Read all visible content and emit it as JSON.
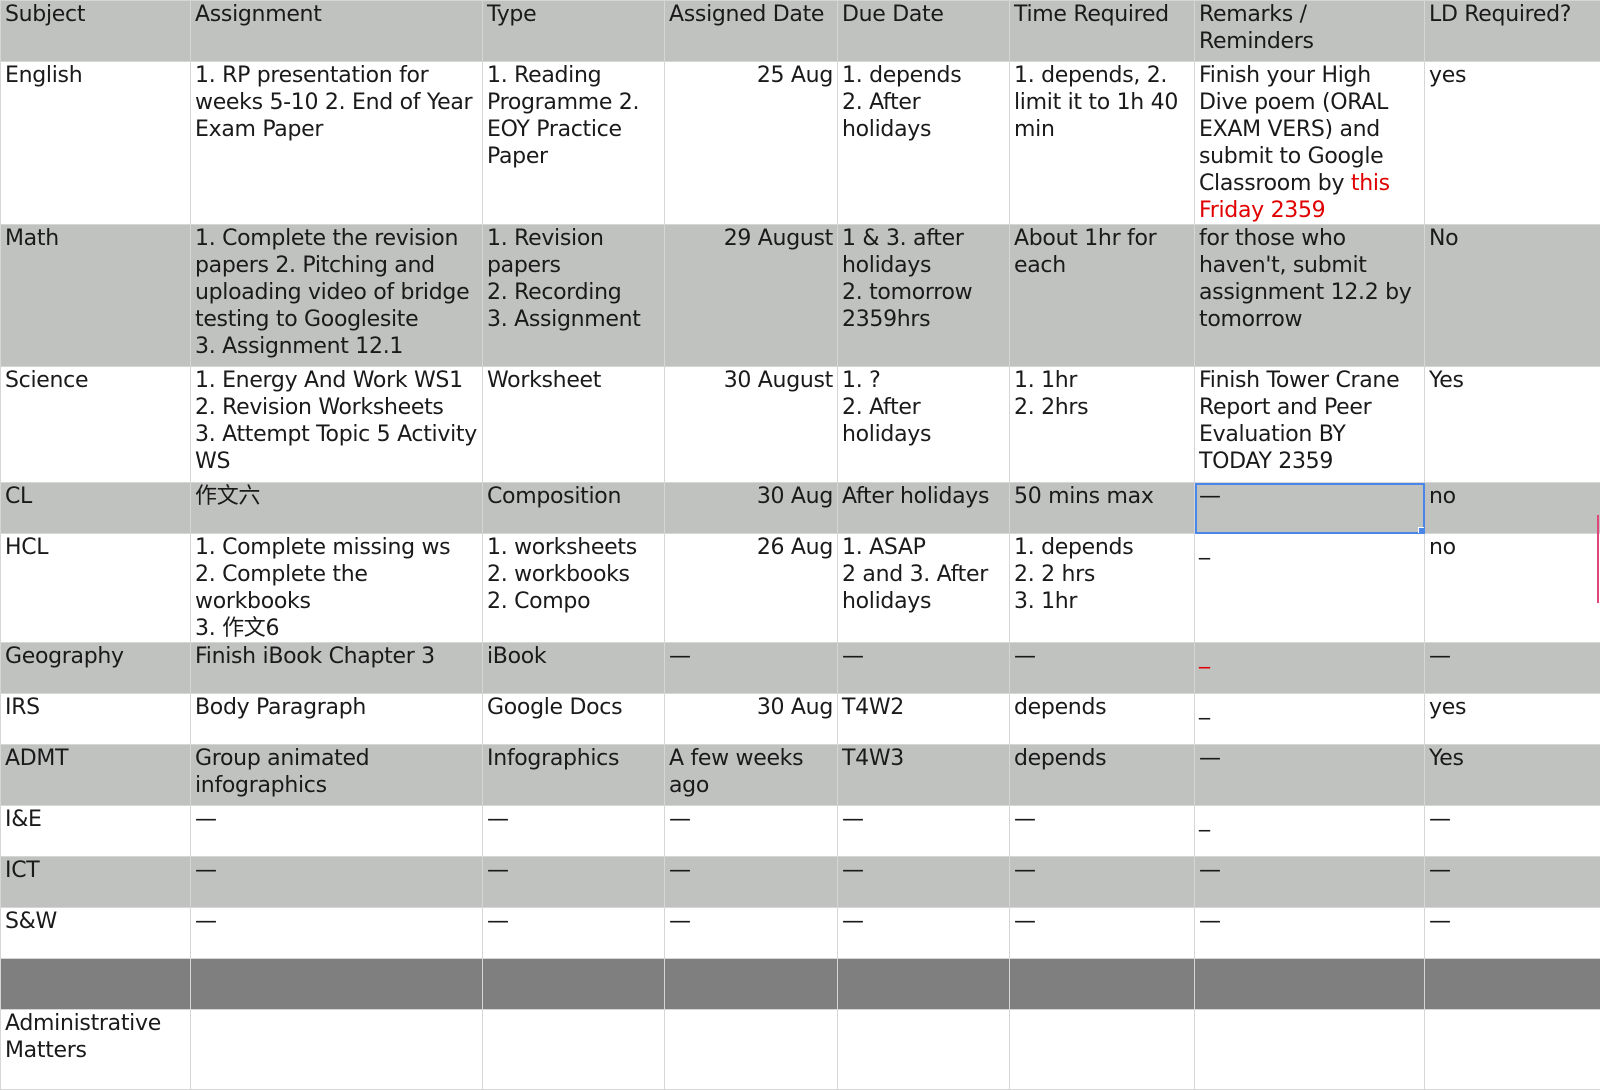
{
  "headers": [
    "Subject",
    "Assignment",
    "Type",
    "Assigned Date",
    "Due Date",
    "Time Required",
    "Remarks / Reminders",
    "LD Required?"
  ],
  "rows": [
    {
      "subject": "English",
      "assignment": "1. RP presentation for weeks 5-10    2. End of Year Exam Paper",
      "type": "1. Reading Programme   2. EOY Practice Paper",
      "assigned": "25 Aug",
      "due": "1. depends\n2. After holidays",
      "time": "1. depends, 2. limit it to 1h 40 min",
      "remarks": "Finish your High Dive poem (ORAL EXAM VERS) and submit to Google Classroom by ",
      "remarks_red": "this Friday 2359",
      "ld": "yes"
    },
    {
      "subject": "Math",
      "assignment": "1. Complete the revision papers     2. Pitching and uploading video of bridge testing to Googlesite\n3. Assignment 12.1",
      "type": "1. Revision papers\n2. Recording\n3. Assignment",
      "assigned": "29 August",
      "due": "1 & 3. after holidays\n2. tomorrow 2359hrs",
      "time": "About 1hr for each",
      "remarks": "for those who haven't, submit assignment 12.2 by tomorrow",
      "ld": "No"
    },
    {
      "subject": "Science",
      "assignment": "1. Energy And Work WS1\n2. Revision Worksheets\n3. Attempt Topic 5 Activity WS",
      "type": "Worksheet",
      "assigned": "30 August",
      "due": "1. ?\n2. After holidays",
      "time": "1. 1hr\n2. 2hrs",
      "remarks": "Finish Tower Crane Report and Peer Evaluation BY TODAY 2359",
      "ld": "Yes"
    },
    {
      "subject": "CL",
      "assignment": "作文六",
      "type": "Composition",
      "assigned": "30 Aug",
      "due": "After holidays",
      "time": "50 mins max",
      "remarks": "—",
      "ld": "no"
    },
    {
      "subject": "HCL",
      "assignment": "1. Complete missing ws\n2. Complete the workbooks\n3. 作文6",
      "type": "1. worksheets\n2. workbooks\n2. Compo",
      "assigned": "26 Aug",
      "due": "1. ASAP\n2 and 3. After holidays",
      "time": "1. depends\n2. 2 hrs\n3. 1hr",
      "remarks": "_",
      "ld": "no"
    },
    {
      "subject": "Geography",
      "assignment": "Finish iBook Chapter 3",
      "type": "iBook",
      "assigned": "—",
      "due": "—",
      "time": "—",
      "remarks": "_",
      "ld": "—"
    },
    {
      "subject": "IRS",
      "assignment": "Body Paragraph",
      "type": "Google Docs",
      "assigned": "30 Aug",
      "due": "T4W2",
      "time": "depends",
      "remarks": "_",
      "ld": "yes"
    },
    {
      "subject": "ADMT",
      "assignment": "Group animated infographics",
      "type": "Infographics",
      "assigned": "A few weeks ago",
      "due": "T4W3",
      "time": "depends",
      "remarks": "—",
      "ld": "Yes"
    },
    {
      "subject": "I&E",
      "assignment": "—",
      "type": "—",
      "assigned": "—",
      "due": "—",
      "time": "—",
      "remarks": "_",
      "ld": "—"
    },
    {
      "subject": "ICT",
      "assignment": "—",
      "type": "—",
      "assigned": "—",
      "due": "—",
      "time": "—",
      "remarks": "—",
      "ld": "—"
    },
    {
      "subject": "S&W",
      "assignment": "—",
      "type": "—",
      "assigned": "—",
      "due": "—",
      "time": "—",
      "remarks": "—",
      "ld": "—"
    }
  ],
  "admin_label": "Administrative Matters",
  "colors": {
    "header_gray": "#c0c2c0",
    "dark_row": "#7f7f7f",
    "selection": "#4a86e8",
    "alert_red": "#e00000"
  }
}
